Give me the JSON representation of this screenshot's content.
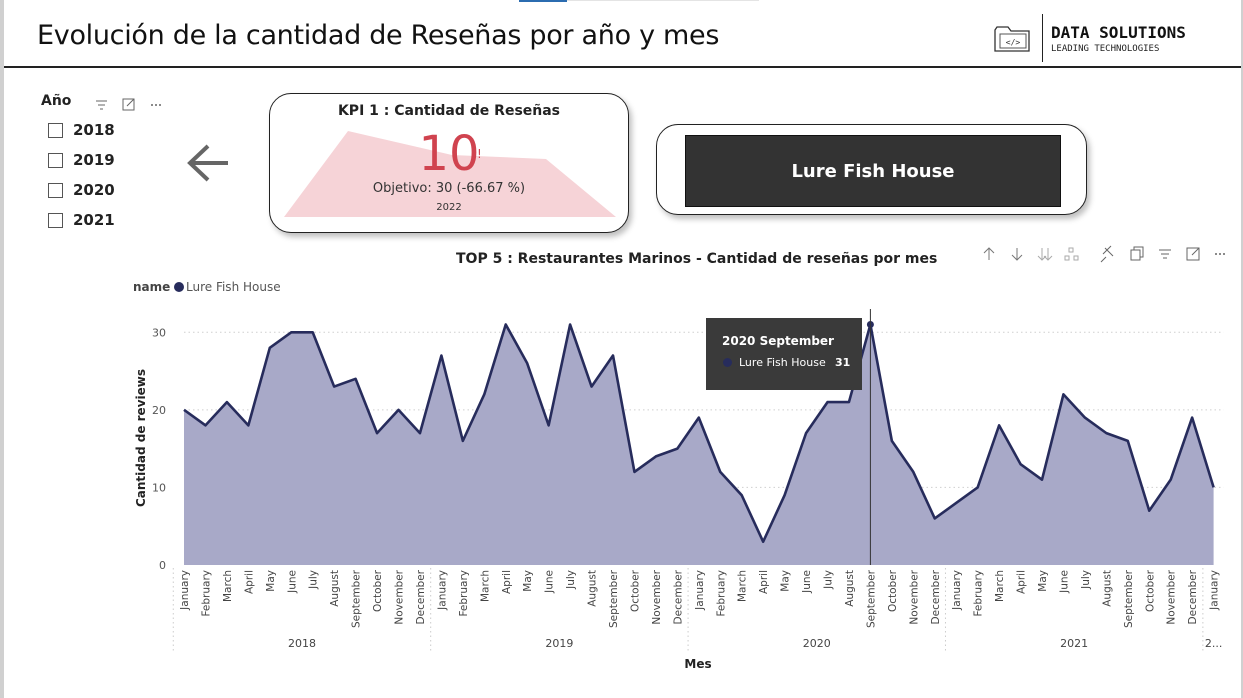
{
  "header": {
    "title": "Evolución de la cantidad de Reseñas por año y mes",
    "logo_name": "DATA SOLUTIONS",
    "logo_tagline": "LEADING TECHNOLOGIES",
    "logo_icon": "folder-code-icon"
  },
  "slicer": {
    "title": "Año",
    "icons": [
      "filter-icon",
      "focus-mode-icon",
      "more-options-icon"
    ],
    "items": [
      {
        "label": "2018",
        "checked": false
      },
      {
        "label": "2019",
        "checked": false
      },
      {
        "label": "2020",
        "checked": false
      },
      {
        "label": "2021",
        "checked": false
      }
    ]
  },
  "back_button": {
    "icon": "arrow-left-icon"
  },
  "kpi": {
    "title": "KPI 1 : Cantidad de Reseñas",
    "value": "10",
    "indicator": "!",
    "goal": "Objetivo: 30 (-66.67 %)",
    "period": "2022",
    "value_color": "#d0434f",
    "trend_color": "#f6d3d7"
  },
  "restaurant_card": {
    "label": "Lure Fish House",
    "background": "#333333"
  },
  "chart_toolbar": {
    "icons": [
      "drill-up-icon",
      "drill-down-icon",
      "expand-all-icon",
      "hierarchy-icon",
      "pin-icon",
      "copy-icon",
      "filter-icon",
      "focus-mode-icon",
      "more-options-icon"
    ]
  },
  "tooltip": {
    "title": "2020 September",
    "series": "Lure Fish House",
    "value": "31"
  },
  "chart_data": {
    "type": "area",
    "title": "TOP 5 : Restaurantes Marinos - Cantidad de reseñas por mes",
    "legend_title": "name",
    "legend_position": "top-left",
    "xlabel": "Mes",
    "ylabel": "Cantidad de reviews",
    "ylim": [
      0,
      33
    ],
    "yticks": [
      0,
      10,
      20,
      30
    ],
    "grid": true,
    "line_color": "#272c5c",
    "fill_color": "#a8a9c8",
    "months": [
      "January",
      "February",
      "March",
      "April",
      "May",
      "June",
      "July",
      "August",
      "September",
      "October",
      "November",
      "December",
      "January",
      "February",
      "March",
      "April",
      "May",
      "June",
      "July",
      "August",
      "September",
      "October",
      "November",
      "December",
      "January",
      "February",
      "March",
      "April",
      "May",
      "June",
      "July",
      "August",
      "September",
      "October",
      "November",
      "December",
      "January",
      "February",
      "March",
      "April",
      "May",
      "June",
      "July",
      "August",
      "September",
      "October",
      "November",
      "December",
      "January"
    ],
    "year_groups": [
      {
        "label": "2018",
        "count": 12
      },
      {
        "label": "2019",
        "count": 12
      },
      {
        "label": "2020",
        "count": 12
      },
      {
        "label": "2021",
        "count": 12
      },
      {
        "label": "2...",
        "count": 1
      }
    ],
    "series": [
      {
        "name": "Lure Fish House",
        "values": [
          20,
          18,
          21,
          18,
          28,
          30,
          30,
          23,
          24,
          17,
          20,
          17,
          27,
          16,
          22,
          31,
          26,
          18,
          31,
          23,
          27,
          12,
          14,
          15,
          19,
          12,
          9,
          3,
          9,
          17,
          21,
          21,
          31,
          16,
          12,
          6,
          8,
          10,
          18,
          13,
          11,
          22,
          19,
          17,
          16,
          7,
          11,
          19,
          10
        ]
      }
    ],
    "highlight_index": 32
  }
}
